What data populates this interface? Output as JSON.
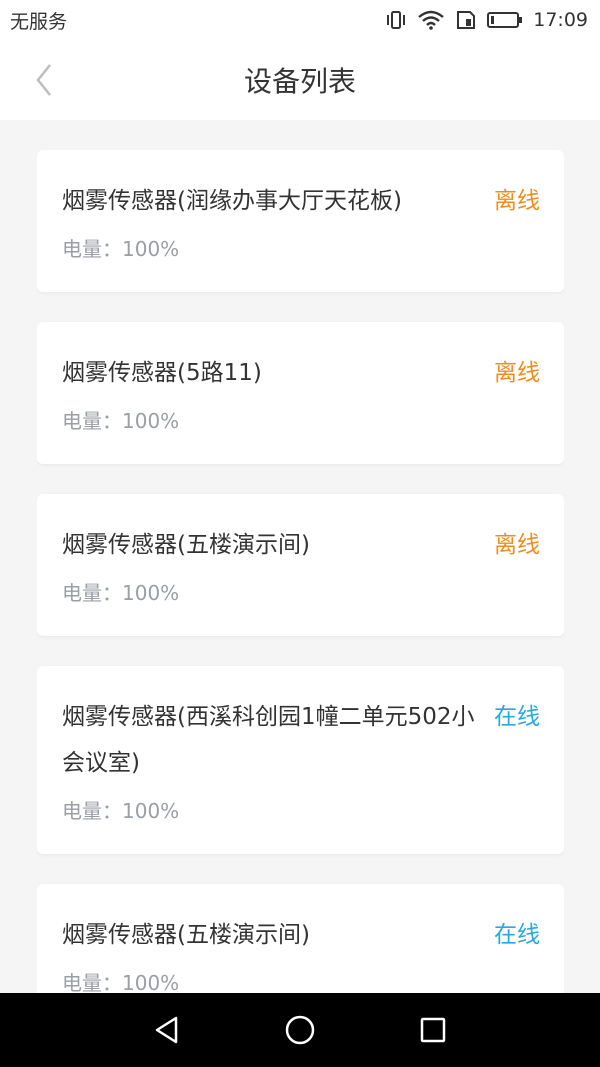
{
  "status_bar": {
    "carrier": "无服务",
    "time": "17:09",
    "icons": [
      "vibrate-icon",
      "wifi-icon",
      "sim-icon",
      "battery-icon"
    ]
  },
  "header": {
    "title": "设备列表",
    "back_icon": "chevron-left-icon"
  },
  "devices": [
    {
      "name": "烟雾传感器(润缘办事大厅天花板)",
      "status": "离线",
      "battery_label": "电量：",
      "battery_value": "100%"
    },
    {
      "name": "烟雾传感器(5路11)",
      "status": "离线",
      "battery_label": "电量：",
      "battery_value": "100%"
    },
    {
      "name": "烟雾传感器(五楼演示间)",
      "status": "离线",
      "battery_label": "电量：",
      "battery_value": "100%"
    },
    {
      "name": "烟雾传感器(西溪科创园1幢二单元502小会议室)",
      "status": "在线",
      "battery_label": "电量：",
      "battery_value": "100%"
    },
    {
      "name": "烟雾传感器(五楼演示间)",
      "status": "在线",
      "battery_label": "电量：",
      "battery_value": "100%"
    }
  ],
  "colors": {
    "offline": "#f08c1c",
    "online": "#29a8e0",
    "secondary_text": "#9a9ea6"
  },
  "android_nav": [
    "back-triangle-icon",
    "home-circle-icon",
    "recents-square-icon"
  ]
}
